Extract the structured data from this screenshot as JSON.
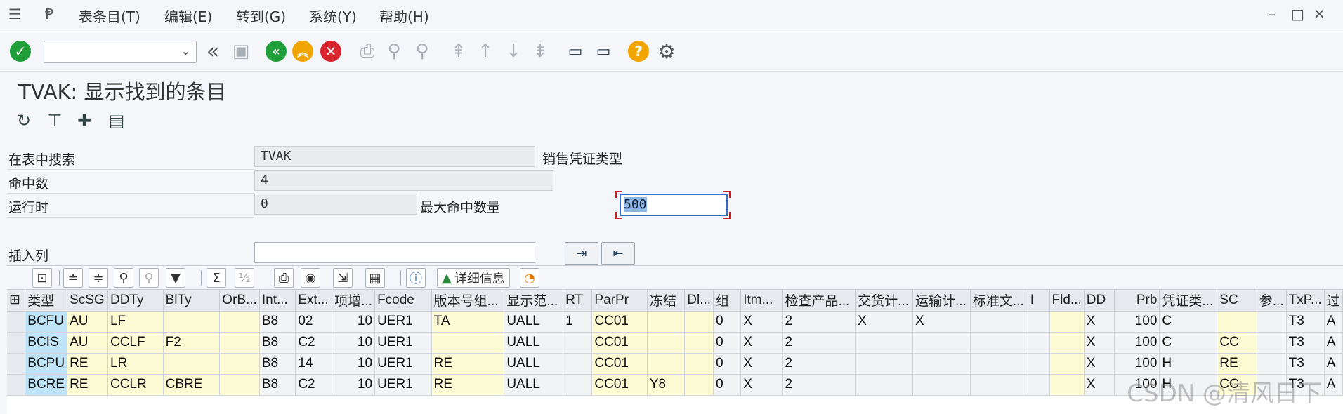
{
  "menu": {
    "items": [
      "表条目(T)",
      "编辑(E)",
      "转到(G)",
      "系统(Y)",
      "帮助(H)"
    ]
  },
  "window_controls": [
    "–",
    "□",
    "✕"
  ],
  "screen": {
    "title": "TVAK: 显示找到的条目"
  },
  "form": {
    "search_table_label": "在表中搜索",
    "search_table_value": "TVAK",
    "search_table_desc": "销售凭证类型",
    "hits_label": "命中数",
    "hits_value": "4",
    "runtime_label": "运行时",
    "runtime_value": "0",
    "max_hits_label": "最大命中数量",
    "max_hits_value": "500",
    "insert_col_label": "插入列"
  },
  "grid_toolbar": {
    "details_label": "详细信息"
  },
  "grid": {
    "columns": [
      "类型",
      "ScSG",
      "DDTy",
      "BlTy",
      "OrB...",
      "Int...",
      "Ext...",
      "项增...",
      "Fcode",
      "版本号组...",
      "显示范...",
      "RT",
      "ParPr",
      "冻结",
      "Dl...",
      "组",
      "Itm...",
      "检查产品...",
      "交货计...",
      "运输计...",
      "标准文...",
      "I",
      "Fld...",
      "DD",
      "Prb",
      "凭证类...",
      "SC",
      "参...",
      "TxP...",
      "过"
    ],
    "rows": [
      [
        "BCFU",
        "AU",
        "LF",
        "",
        "",
        "B8",
        "02",
        "10",
        "UER1",
        "TA",
        "UALL",
        "1",
        "CC01",
        "",
        "",
        "0",
        "X",
        "2",
        "X",
        "X",
        "",
        "",
        "",
        "X",
        "100",
        "C",
        "",
        "",
        "T3",
        "A"
      ],
      [
        "BCIS",
        "AU",
        "CCLF",
        "F2",
        "",
        "B8",
        "C2",
        "10",
        "UER1",
        "",
        "UALL",
        "",
        "CC01",
        "",
        "",
        "0",
        "X",
        "2",
        "",
        "",
        "",
        "",
        "",
        "X",
        "100",
        "C",
        "CC",
        "",
        "T3",
        "A"
      ],
      [
        "BCPU",
        "RE",
        "LR",
        "",
        "",
        "B8",
        "14",
        "10",
        "UER1",
        "RE",
        "UALL",
        "",
        "CC01",
        "",
        "",
        "0",
        "X",
        "2",
        "",
        "",
        "",
        "",
        "",
        "X",
        "100",
        "H",
        "RE",
        "",
        "T3",
        "A"
      ],
      [
        "BCRE",
        "RE",
        "CCLR",
        "CBRE",
        "",
        "B8",
        "C2",
        "10",
        "UER1",
        "RE",
        "UALL",
        "",
        "CC01",
        "Y8",
        "",
        "0",
        "X",
        "2",
        "",
        "",
        "",
        "",
        "",
        "X",
        "100",
        "H",
        "CC",
        "",
        "T3",
        "A"
      ]
    ]
  },
  "watermark": "CSDN @清风日下",
  "colors": {
    "key_cell": "#bfe4f7",
    "yellow_cell": "#fdfbd4",
    "ok_green": "#1f9e39",
    "cancel_red": "#d9232d",
    "nav_orange": "#f0a500"
  }
}
